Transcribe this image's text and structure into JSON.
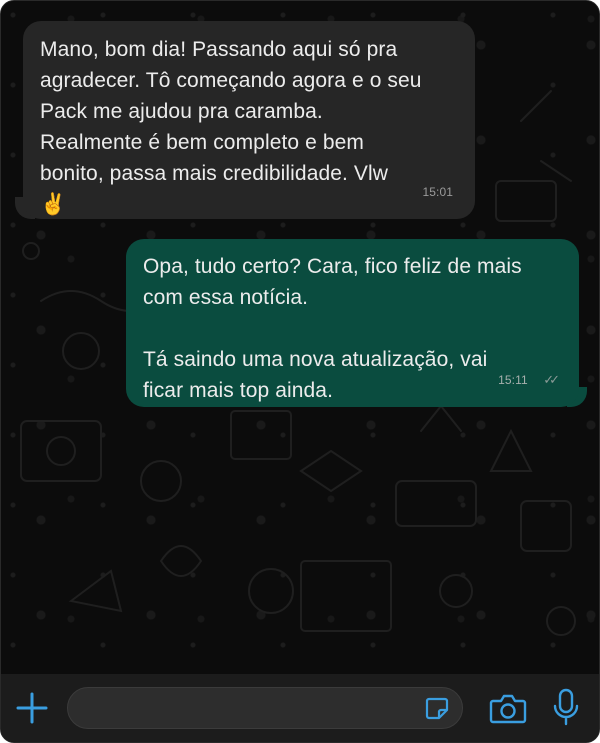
{
  "messages": [
    {
      "direction": "incoming",
      "text": "Mano, bom dia! Passando aqui só pra\nagradecer. Tô começando agora e o seu\nPack me ajudou pra caramba.\nRealmente é bem completo e bem\nbonito, passa mais credibilidade. Vlw\n✌️",
      "time": "15:01"
    },
    {
      "direction": "outgoing",
      "text": "Opa, tudo certo? Cara, fico feliz de mais\ncom essa notícia.\n\nTá saindo uma nova atualização, vai\nficar mais top ainda.",
      "time": "15:11",
      "status": "read-double-check-icon"
    }
  ],
  "composer": {
    "input_value": "",
    "icons": {
      "add": "plus-icon",
      "sticker": "sticker-icon",
      "camera": "camera-icon",
      "mic": "microphone-icon"
    }
  },
  "colors": {
    "background": "#0c0c0c",
    "incoming_bubble": "#262626",
    "outgoing_bubble": "#0a4c3f",
    "accent": "#3a9ee0"
  }
}
